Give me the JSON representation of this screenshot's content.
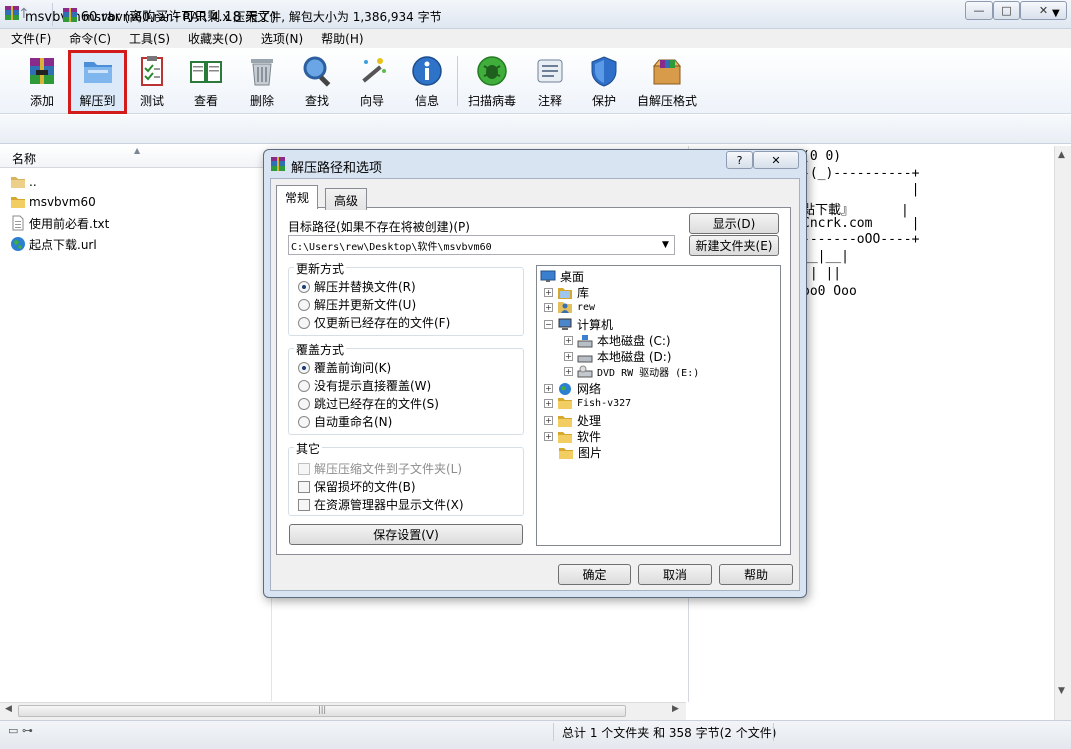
{
  "window": {
    "title": "msvbvm60.rar (离购买许可只剩 18 天了)",
    "controls": {
      "minimize": "—",
      "maximize": "□",
      "close": "✕"
    }
  },
  "menu": [
    "文件(F)",
    "命令(C)",
    "工具(S)",
    "收藏夹(O)",
    "选项(N)",
    "帮助(H)"
  ],
  "toolbar": {
    "add": "添加",
    "extract_to": "解压到",
    "test": "测试",
    "view": "查看",
    "delete": "删除",
    "find": "查找",
    "wizard": "向导",
    "info": "信息",
    "scan": "扫描病毒",
    "comment": "注释",
    "protect": "保护",
    "sfx": "自解压格式"
  },
  "address": {
    "up": "↑",
    "path": "msvbvm60.rar - RAR 4.x 压缩文件, 解包大小为 1,386,934 字节",
    "dropdown": "▼"
  },
  "filelist": {
    "header": "名称",
    "items": [
      {
        "name": "..",
        "icon": "folder-up-icon"
      },
      {
        "name": "msvbvm60",
        "icon": "folder-icon"
      },
      {
        "name": "使用前必看.txt",
        "icon": "text-file-icon"
      },
      {
        "name": "起点下载.url",
        "icon": "globe-icon"
      }
    ]
  },
  "comment": {
    "lines": [
      "(0 0)",
      "-(_)----------+",
      "              |",
      "點下載』      |",
      "Cncrk.com     |",
      "-------oOO----+",
      "__|__|",
      "|| ||",
      "oo0 Ooo"
    ]
  },
  "status": {
    "text": "总计 1 个文件夹 和 358 字节(2 个文件)"
  },
  "dialog": {
    "title": "解压路径和选项",
    "help": "?",
    "close": "✕",
    "tabs": {
      "general": "常规",
      "advanced": "高级"
    },
    "dest_label": "目标路径(如果不存在将被创建)(P)",
    "dest_value": "C:\\Users\\rew\\Desktop\\软件\\msvbvm60",
    "show_button": "显示(D)",
    "new_folder_button": "新建文件夹(E)",
    "update": {
      "title": "更新方式",
      "options": [
        "解压并替换文件(R)",
        "解压并更新文件(U)",
        "仅更新已经存在的文件(F)"
      ],
      "selected": 0
    },
    "overwrite": {
      "title": "覆盖方式",
      "options": [
        "覆盖前询问(K)",
        "没有提示直接覆盖(W)",
        "跳过已经存在的文件(S)",
        "自动重命名(N)"
      ],
      "selected": 0
    },
    "misc": {
      "title": "其它",
      "options": [
        "解压压缩文件到子文件夹(L)",
        "保留损坏的文件(B)",
        "在资源管理器中显示文件(X)"
      ]
    },
    "save_button": "保存设置(V)",
    "tree": {
      "desktop": "桌面",
      "library": "库",
      "user": "rew",
      "computer": "计算机",
      "disk_c": "本地磁盘 (C:)",
      "disk_d": "本地磁盘 (D:)",
      "dvd": "DVD RW 驱动器 (E:)",
      "network": "网络",
      "fish": "Fish-v327",
      "process": "处理",
      "software": "软件",
      "pictures": "图片"
    },
    "ok": "确定",
    "cancel": "取消",
    "help_button": "帮助"
  }
}
